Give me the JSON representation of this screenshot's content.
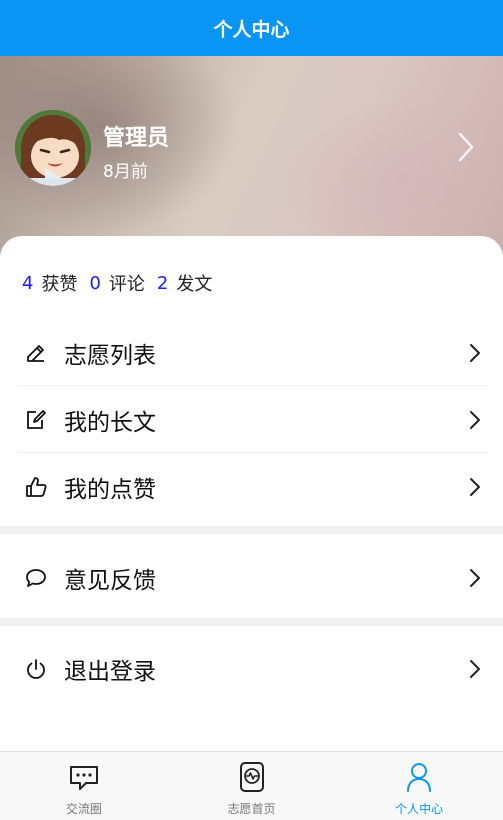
{
  "header": {
    "title": "个人中心"
  },
  "profile": {
    "name": "管理员",
    "time": "8月前"
  },
  "stats": [
    {
      "value": "4",
      "label": "获赞"
    },
    {
      "value": "0",
      "label": "评论"
    },
    {
      "value": "2",
      "label": "发文"
    }
  ],
  "menu": [
    {
      "label": "志愿列表",
      "icon": "edit-icon"
    },
    {
      "label": "我的长文",
      "icon": "edit-square-icon"
    },
    {
      "label": "我的点赞",
      "icon": "thumbs-up-icon"
    },
    {
      "label": "意见反馈",
      "icon": "chat-bubble-icon"
    },
    {
      "label": "退出登录",
      "icon": "power-icon"
    }
  ],
  "tabs": [
    {
      "label": "交流圈",
      "icon": "chat-icon",
      "active": false
    },
    {
      "label": "志愿首页",
      "icon": "heart-rate-icon",
      "active": false
    },
    {
      "label": "个人中心",
      "icon": "person-icon",
      "active": true
    }
  ],
  "colors": {
    "brand": "#0a95f5",
    "stat_number": "#1a1aff"
  }
}
